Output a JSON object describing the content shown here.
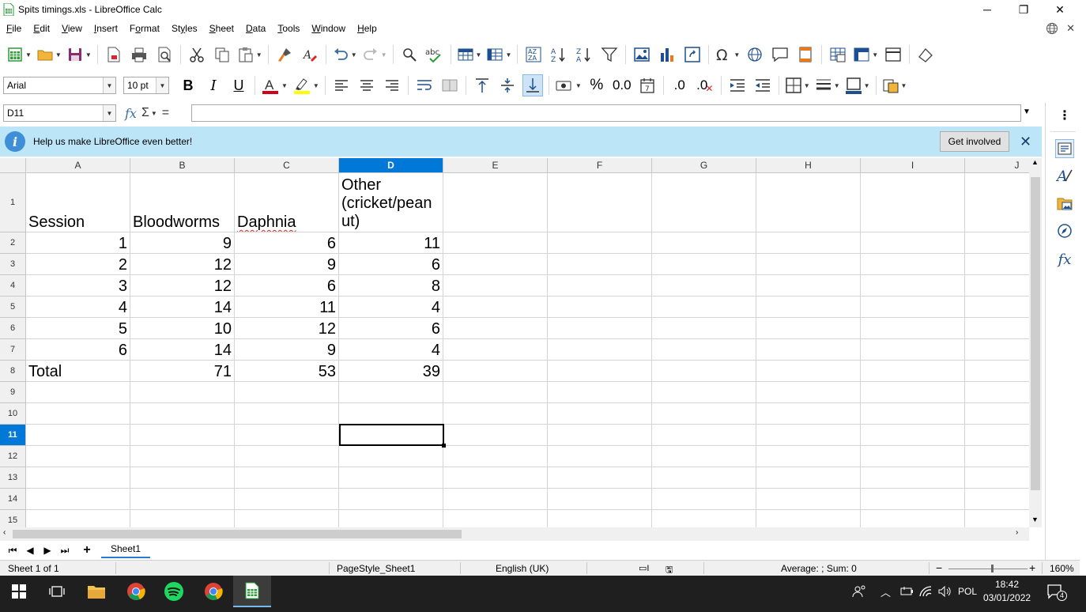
{
  "window": {
    "title": "Spits timings.xls - LibreOffice Calc",
    "minimize_glyph": "─",
    "restore_glyph": "❐",
    "close_glyph": "✕"
  },
  "menu": [
    {
      "label": "File",
      "underline": "F",
      "rest": "ile"
    },
    {
      "label": "Edit",
      "underline": "E",
      "rest": "dit"
    },
    {
      "label": "View",
      "underline": "V",
      "rest": "iew"
    },
    {
      "label": "Insert",
      "underline": "I",
      "rest": "nsert"
    },
    {
      "label": "Format",
      "underline": "o",
      "pre": "F",
      "rest": "rmat"
    },
    {
      "label": "Styles",
      "underline": "y",
      "pre": "St",
      "rest": "les"
    },
    {
      "label": "Sheet",
      "underline": "S",
      "rest": "heet"
    },
    {
      "label": "Data",
      "underline": "D",
      "rest": "ata"
    },
    {
      "label": "Tools",
      "underline": "T",
      "rest": "ools"
    },
    {
      "label": "Window",
      "underline": "W",
      "rest": "indow"
    },
    {
      "label": "Help",
      "underline": "H",
      "rest": "elp"
    }
  ],
  "format_bar": {
    "font_name": "Arial",
    "font_size": "10 pt",
    "bold": "B",
    "italic": "I",
    "underline": "U",
    "font_color": "#d0021b",
    "highlight_color": "#ffff00",
    "percent": "%",
    "decimal_format": "0.0",
    "add_decimal": ".0",
    "remove_decimal": ".0"
  },
  "formula_bar": {
    "name_box": "D11",
    "fx": "fx",
    "sigma": "Σ",
    "equals": "=",
    "content": ""
  },
  "infobar": {
    "message": "Help us make LibreOffice even better!",
    "button": "Get involved",
    "info_glyph": "i",
    "close_glyph": "✕"
  },
  "sheet": {
    "columns": [
      "A",
      "B",
      "C",
      "D",
      "E",
      "F",
      "G",
      "H",
      "I",
      "J"
    ],
    "active_column": "D",
    "rows": [
      "1",
      "2",
      "3",
      "4",
      "5",
      "6",
      "7",
      "8",
      "9",
      "10",
      "11",
      "12",
      "13",
      "14",
      "15"
    ],
    "active_row": "11",
    "header_row": [
      "Session",
      "Bloodworms",
      "Daphnia",
      "Other\n(cricket/pean\nut)"
    ],
    "data": [
      [
        "1",
        "9",
        "6",
        "11"
      ],
      [
        "2",
        "12",
        "9",
        "6"
      ],
      [
        "3",
        "12",
        "6",
        "8"
      ],
      [
        "4",
        "14",
        "11",
        "4"
      ],
      [
        "5",
        "10",
        "12",
        "6"
      ],
      [
        "6",
        "14",
        "9",
        "4"
      ]
    ],
    "total_row": [
      "Total",
      "71",
      "53",
      "39"
    ],
    "selected_cell": "D11"
  },
  "tabs": {
    "first": "⏮",
    "prev": "◀",
    "next": "▶",
    "last": "⏭",
    "add": "+",
    "sheets": [
      "Sheet1"
    ]
  },
  "status": {
    "sheet_info": "Sheet 1 of 1",
    "page_style": "PageStyle_Sheet1",
    "language": "English (UK)",
    "sum_info": "Average: ; Sum: 0",
    "zoom": "160%",
    "zoom_minus": "−",
    "zoom_plus": "+"
  },
  "taskbar": {
    "time": "18:42",
    "date": "03/01/2022",
    "language": "POL",
    "notification_count": "4"
  }
}
